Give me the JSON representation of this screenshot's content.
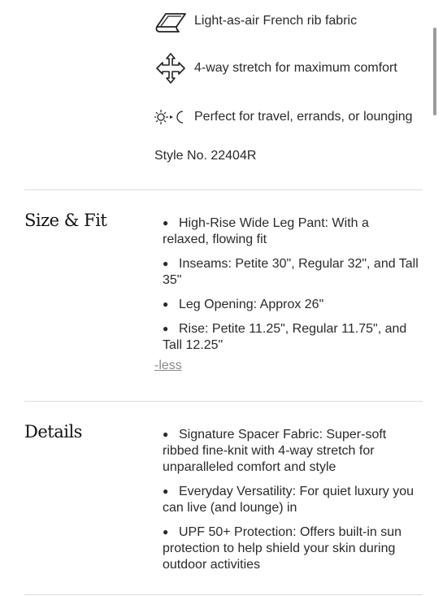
{
  "features": [
    {
      "icon": "fabric-fold-icon",
      "label": "Light-as-air French rib fabric"
    },
    {
      "icon": "four-way-arrows-icon",
      "label": "4-way stretch for maximum comfort"
    },
    {
      "icon": "sun-moon-icon",
      "label": "Perfect for travel, errands, or lounging"
    }
  ],
  "style_number": "Style No. 22404R",
  "size_fit": {
    "title": "Size & Fit",
    "items": [
      "High-Rise Wide Leg Pant: With a relaxed, flowing fit",
      "Inseams: Petite 30\", Regular 32\", and Tall 35\"",
      "Leg Opening: Approx 26\"",
      "Rise: Petite 11.25\", Regular 11.75\", and Tall 12.25\""
    ],
    "less_label": "-less"
  },
  "details": {
    "title": "Details",
    "items": [
      "Signature Spacer Fabric: Super-soft ribbed fine-knit with 4-way stretch for unparalleled comfort and style",
      "Everyday Versatility: For quiet luxury you can live (and lounge) in",
      "UPF 50+ Protection: Offers built-in sun protection to help shield your skin during outdoor activities"
    ]
  },
  "bullet_glyph": "●"
}
